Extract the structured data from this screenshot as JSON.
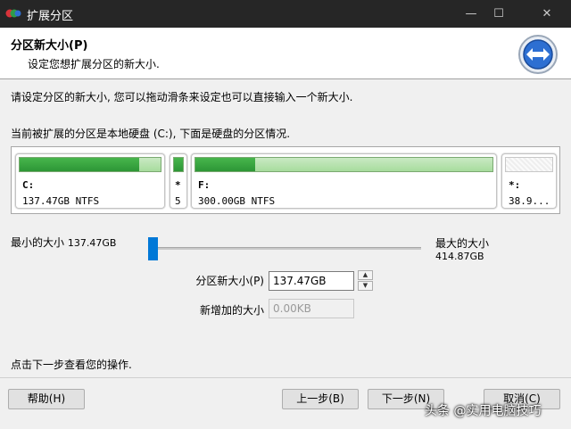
{
  "window": {
    "title": "扩展分区",
    "controls": {
      "minimize": "—",
      "maximize": "☐",
      "close": "✕"
    }
  },
  "header": {
    "title": "分区新大小(P)",
    "subtitle": "设定您想扩展分区的新大小."
  },
  "main": {
    "instruction": "请设定分区的新大小, 您可以拖动滑条来设定也可以直接输入一个新大小.",
    "disk_description": "当前被扩展的分区是本地硬盘 (C:), 下面是硬盘的分区情况."
  },
  "disk_map": {
    "partitions": [
      {
        "label": "C:",
        "size": "137.47GB NTFS",
        "used_fraction": 0.85,
        "selected": true
      },
      {
        "label": "*",
        "size": "5",
        "used_fraction": 1.0,
        "selected": false
      },
      {
        "label": "F:",
        "size": "300.00GB NTFS",
        "used_fraction": 0.2,
        "selected": false
      },
      {
        "label": "*:",
        "size": "38.9...",
        "used_fraction": 0.0,
        "selected": false
      }
    ]
  },
  "slider": {
    "min_label": "最小的大小",
    "min_value": "137.47GB",
    "max_label": "最大的大小",
    "max_value": "414.87GB",
    "position_fraction": 0.0
  },
  "fields": {
    "new_size_label": "分区新大小(P)",
    "new_size_value": "137.47GB",
    "added_size_label": "新增加的大小",
    "added_size_value": "0.00KB"
  },
  "footer": {
    "hint": "点击下一步查看您的操作."
  },
  "buttons": {
    "help": "帮助(H)",
    "back": "上一步(B)",
    "next": "下一步(N)",
    "cancel": "取消(C)"
  },
  "watermark": "头条 @实用电脑技巧",
  "colors": {
    "accent": "#0078d7",
    "partition_fill": "#2d9636",
    "titlebar": "#262626"
  }
}
